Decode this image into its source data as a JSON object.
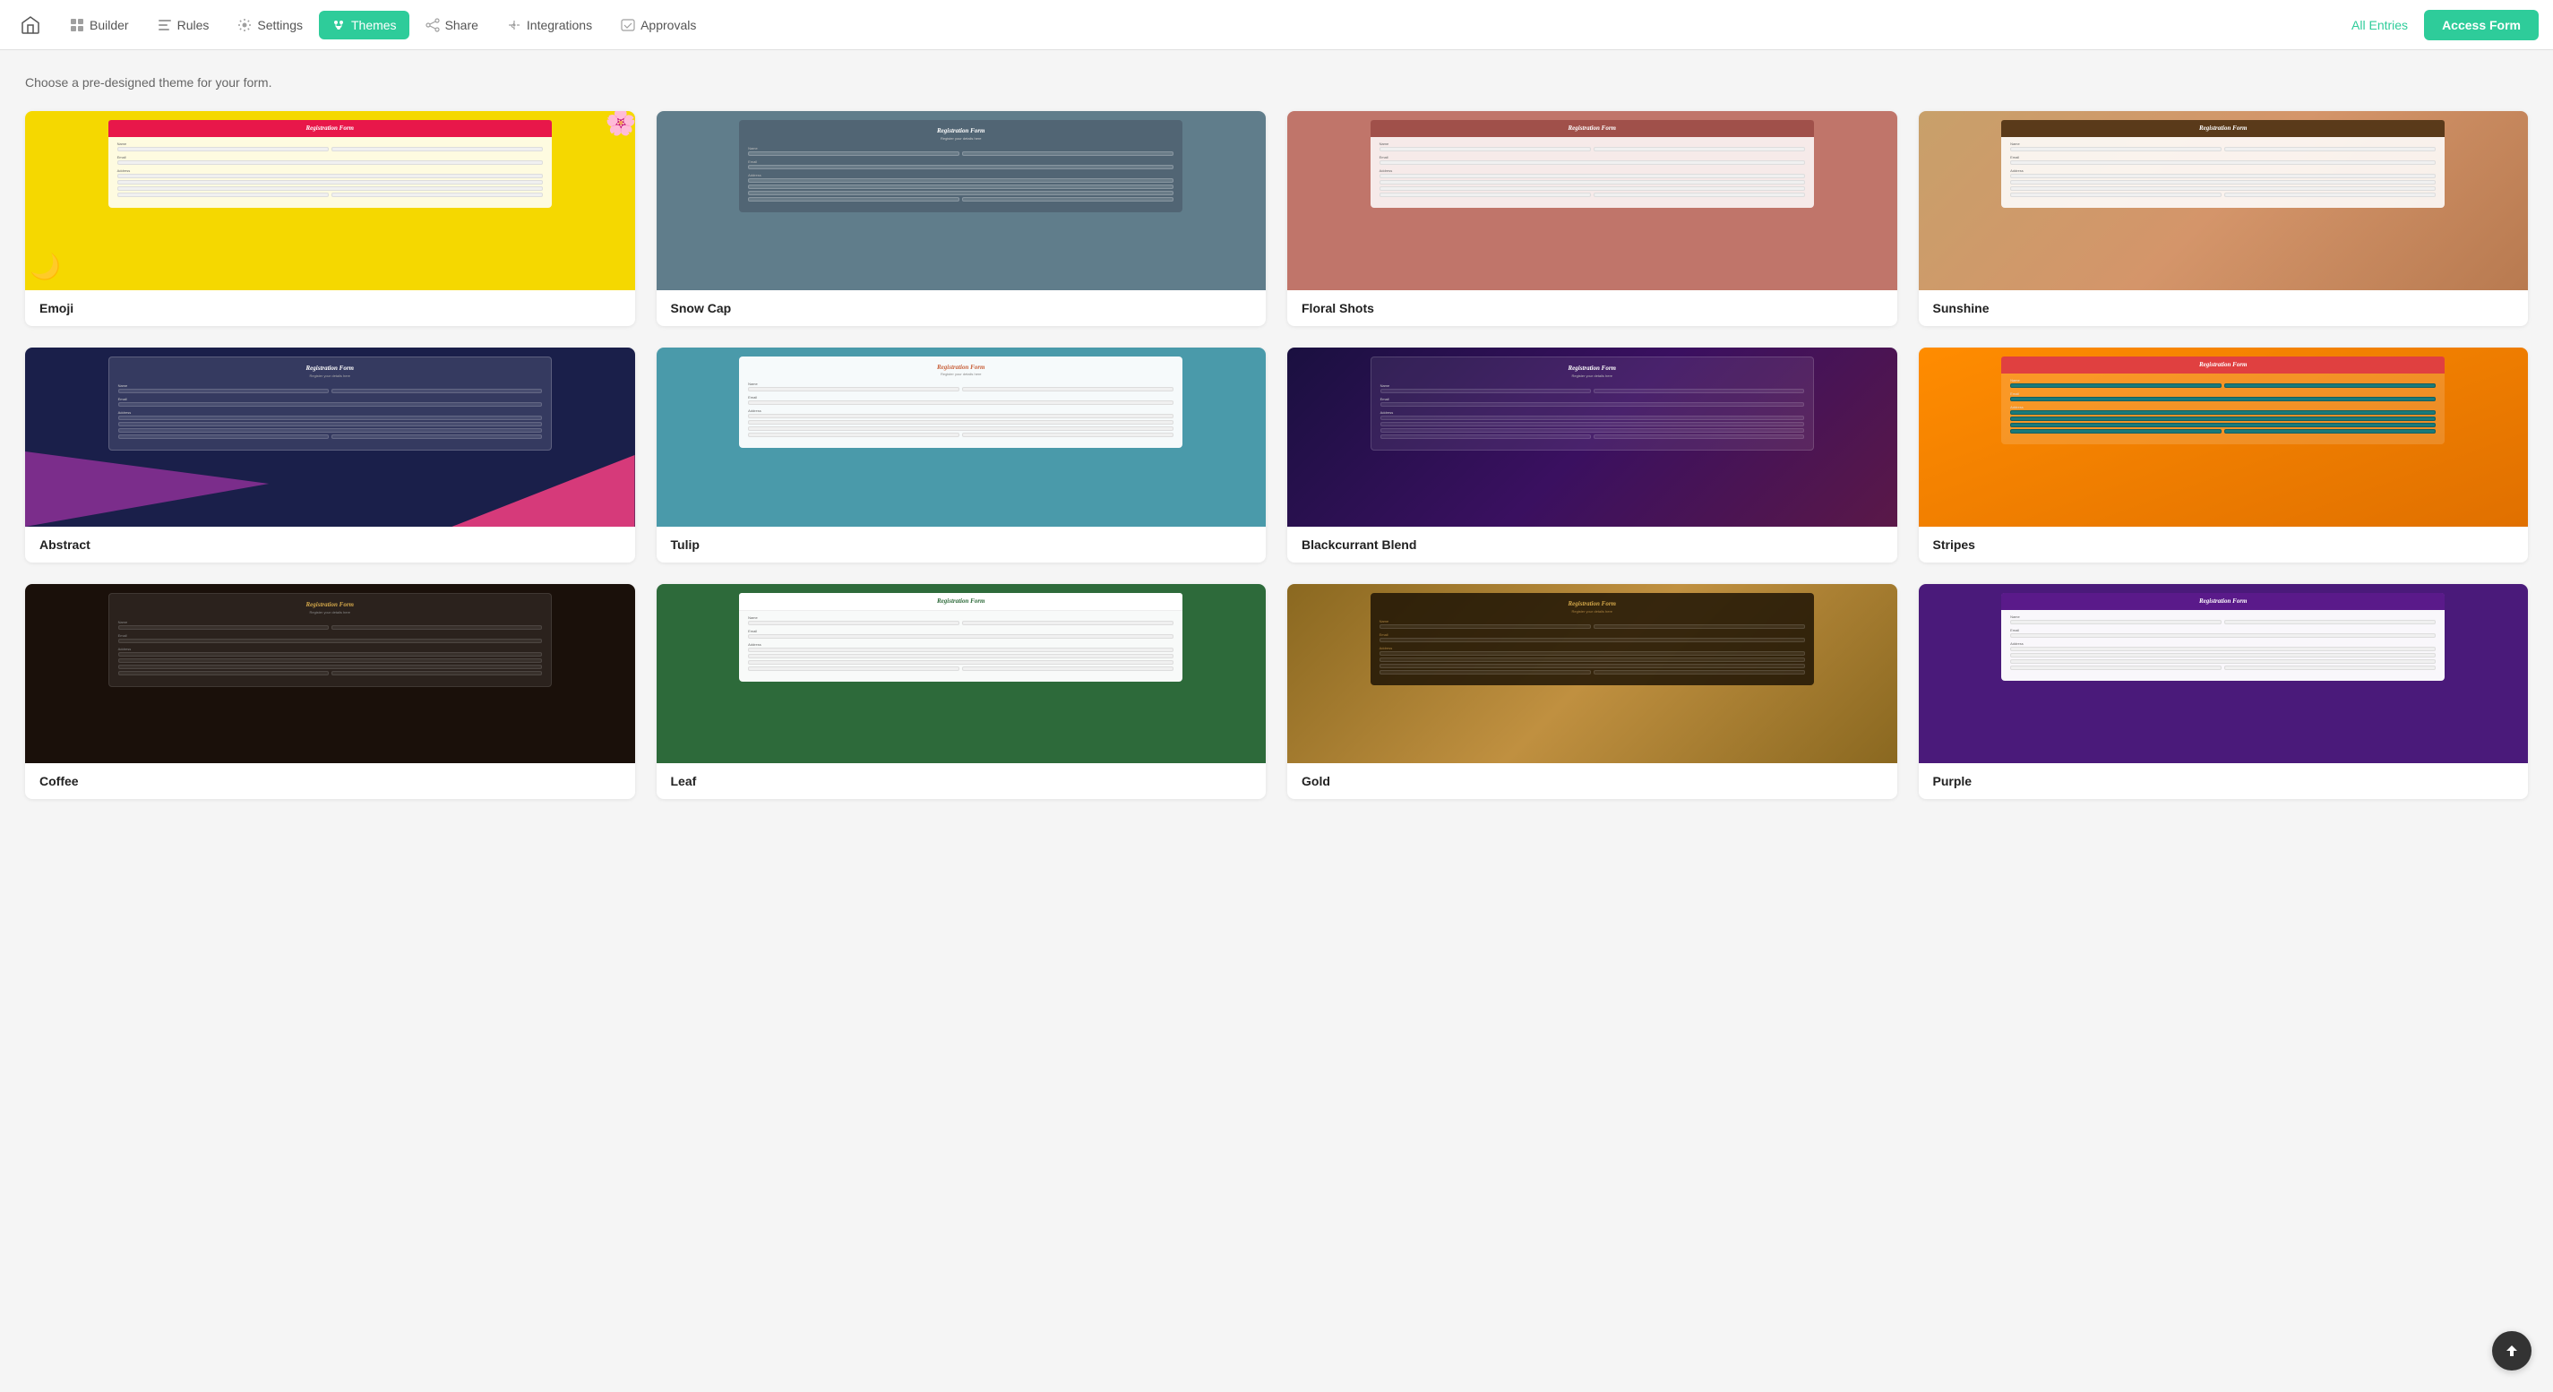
{
  "nav": {
    "home_label": "Home",
    "items": [
      {
        "id": "builder",
        "label": "Builder",
        "icon": "layout-icon"
      },
      {
        "id": "rules",
        "label": "Rules",
        "icon": "rules-icon"
      },
      {
        "id": "settings",
        "label": "Settings",
        "icon": "settings-icon"
      },
      {
        "id": "themes",
        "label": "Themes",
        "icon": "themes-icon",
        "active": true
      },
      {
        "id": "share",
        "label": "Share",
        "icon": "share-icon"
      },
      {
        "id": "integrations",
        "label": "Integrations",
        "icon": "integrations-icon"
      },
      {
        "id": "approvals",
        "label": "Approvals",
        "icon": "approvals-icon"
      }
    ],
    "all_entries_label": "All Entries",
    "access_form_label": "Access Form"
  },
  "page": {
    "subtitle": "Choose a pre-designed theme for your form."
  },
  "themes": [
    {
      "id": "emoji",
      "name": "Emoji",
      "bg_class": "bg-emoji"
    },
    {
      "id": "snowcap",
      "name": "Snow Cap",
      "bg_class": "bg-snowcap"
    },
    {
      "id": "floral",
      "name": "Floral Shots",
      "bg_class": "bg-floral"
    },
    {
      "id": "sunshine",
      "name": "Sunshine",
      "bg_class": "bg-sunshine"
    },
    {
      "id": "abstract",
      "name": "Abstract",
      "bg_class": "bg-abstract"
    },
    {
      "id": "tulip",
      "name": "Tulip",
      "bg_class": "bg-tulip"
    },
    {
      "id": "blackcurrant",
      "name": "Blackcurrant Blend",
      "bg_class": "bg-blackcurrant"
    },
    {
      "id": "stripes",
      "name": "Stripes",
      "bg_class": "bg-stripes"
    },
    {
      "id": "coffee",
      "name": "Coffee",
      "bg_class": "bg-coffee"
    },
    {
      "id": "leaf",
      "name": "Leaf",
      "bg_class": "bg-leaf"
    },
    {
      "id": "gold",
      "name": "Gold",
      "bg_class": "bg-gold"
    },
    {
      "id": "purple",
      "name": "Purple",
      "bg_class": "bg-purple"
    }
  ]
}
